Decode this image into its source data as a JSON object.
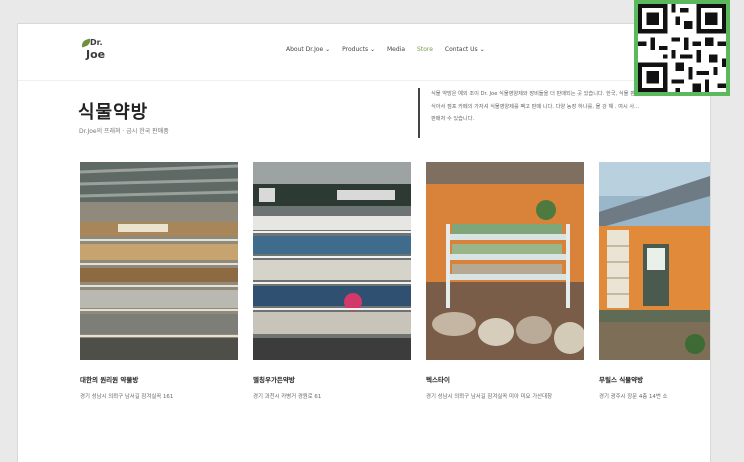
{
  "brand": {
    "line1": "Dr.",
    "line2": "Joe"
  },
  "nav": [
    {
      "label": "About Dr.Joe ⌄"
    },
    {
      "label": "Products ⌄"
    },
    {
      "label": "Media"
    },
    {
      "label": "Store"
    },
    {
      "label": "Contact Us ⌄"
    }
  ],
  "page": {
    "title": "식물약방",
    "subtitle": "Dr.Joe의 프래쳐 · 금시 한국 판매품",
    "description": [
      "식물 약방은 예외 조이 Dr. Joe 식물영양제와 장비들을 더 판매되는 곳 있습니다. 한국, 식물 판매",
      "식아서 점포 카페의 가자셔 식물영양제를 팩고 판매 니다. 다양 농장 하나를, 몰 강 해 . 여시 사...",
      "판매처 수 있습니다."
    ]
  },
  "cards": [
    {
      "title": "대한의 원리원 약물방",
      "desc": "경기 성남시 의뢰구 남서길 잠겨실꼭 161"
    },
    {
      "title": "델칭우가든약방",
      "desc": "경기 과천시 카병거 경원로 61"
    },
    {
      "title": "텍스타이",
      "desc": "경기 성남시 의뢰구 남서길 잠겨실꼭 미아 미요 가산대창"
    },
    {
      "title": "무릴스 식물약방",
      "desc": "경기 광주시 장문 4층 14번 소"
    }
  ]
}
